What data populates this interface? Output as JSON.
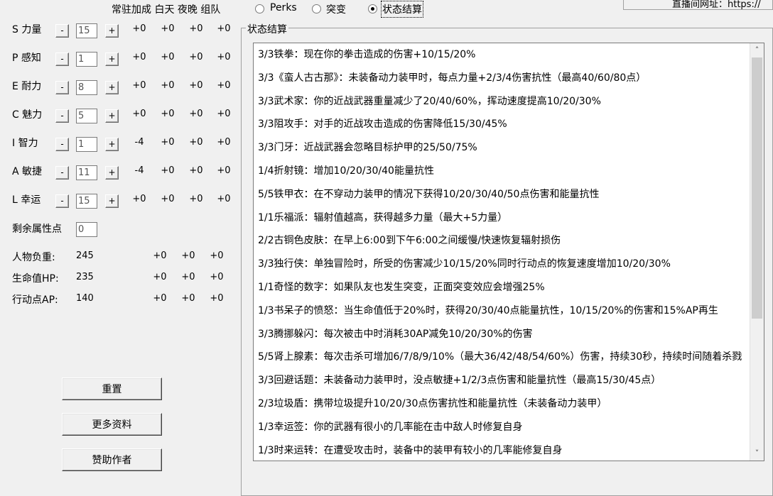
{
  "header": {
    "columns": "常驻加成 白天 夜晚 组队",
    "tabs": [
      {
        "label": "Perks",
        "checked": false
      },
      {
        "label": "突变",
        "checked": false
      },
      {
        "label": "状态结算",
        "checked": true
      }
    ],
    "url_label": "直播间网址：https://"
  },
  "stats": [
    {
      "label": "S 力量",
      "value": "15",
      "bonuses": [
        "+0",
        "+0",
        "+0",
        "+0"
      ]
    },
    {
      "label": "P 感知",
      "value": "1",
      "bonuses": [
        "+0",
        "+0",
        "+0",
        "+0"
      ]
    },
    {
      "label": "E 耐力",
      "value": "8",
      "bonuses": [
        "+0",
        "+0",
        "+0",
        "+0"
      ]
    },
    {
      "label": "C 魅力",
      "value": "5",
      "bonuses": [
        "+0",
        "+0",
        "+0",
        "+0"
      ]
    },
    {
      "label": "I 智力",
      "value": "1",
      "bonuses": [
        "-4",
        "+0",
        "+0",
        "+0"
      ]
    },
    {
      "label": "A 敏捷",
      "value": "11",
      "bonuses": [
        "-4",
        "+0",
        "+0",
        "+0"
      ]
    },
    {
      "label": "L 幸运",
      "value": "15",
      "bonuses": [
        "+0",
        "+0",
        "+0",
        "+0"
      ]
    }
  ],
  "minus_label": "-",
  "plus_label": "+",
  "remaining": {
    "label": "剩余属性点",
    "value": "0"
  },
  "derived": [
    {
      "label": "人物负重:",
      "value": "245",
      "bonuses": [
        "+0",
        "+0",
        "+0"
      ]
    },
    {
      "label": "生命值HP:",
      "value": "235",
      "bonuses": [
        "+0",
        "+0",
        "+0"
      ]
    },
    {
      "label": "行动点AP:",
      "value": "140",
      "bonuses": [
        "+0",
        "+0",
        "+0"
      ]
    }
  ],
  "buttons": {
    "reset": "重置",
    "more_info": "更多资料",
    "sponsor": "赞助作者"
  },
  "results": {
    "title": "状态结算",
    "lines": [
      "3/3铁拳：现在你的拳击造成的伤害+10/15/20%",
      "3/3《蛮人古古那》：未装备动力装甲时，每点力量+2/3/4伤害抗性（最高40/60/80点）",
      "3/3武术家：你的近战武器重量减少了20/40/60%，挥动速度提高10/20/30%",
      "3/3阻攻手：对手的近战攻击造成的伤害降低15/30/45%",
      "3/3门牙：近战武器会忽略目标护甲的25/50/75%",
      "1/4折射镜：增加10/20/30/40能量抗性",
      "5/5铁甲衣：在不穿动力装甲的情况下获得10/20/30/40/50点伤害和能量抗性",
      "1/1乐福派：辐射值越高，获得越多力量（最大+5力量）",
      "2/2古铜色皮肤：在早上6:00到下午6:00之间缓慢/快速恢复辐射损伤",
      "3/3独行侠：单独冒险时，所受的伤害减少10/15/20%同时行动点的恢复速度增加10/20/30%",
      "1/1奇怪的数字：如果队友也发生突变，正面突变效应会增强25%",
      "1/3书呆子的愤怒：当生命值低于20%时，获得20/30/40点能量抗性，10/15/20%的伤害和15%AP再生",
      "3/3腾挪躲闪：每次被击中时消耗30AP减免10/20/30%的伤害",
      "5/5肾上腺素：每次击杀可增加6/7/8/9/10%（最大36/42/48/54/60%）伤害，持续30秒，持续时间随着杀戮",
      "3/3回避话题：未装备动力装甲时，没点敏捷+1/2/3点伤害和能量抗性（最高15/30/45点）",
      "2/3垃圾盾：携带垃圾提升10/20/30点伤害抗性和能量抗性（未装备动力装甲）",
      "1/3幸运签：你的武器有很小的几率能在击中敌人时修复自身",
      "1/3时来运转：在遭受攻击时，装备中的装甲有较小的几率能修复自身"
    ]
  },
  "scroll_up_icon": "chevron-up-icon",
  "scroll_down_icon": "chevron-down-icon"
}
